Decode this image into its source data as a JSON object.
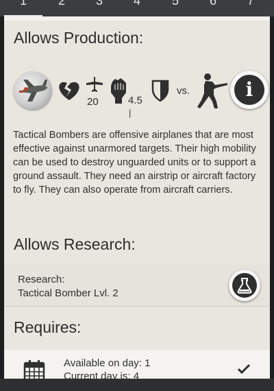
{
  "tabs": [
    "1",
    "2",
    "3",
    "4",
    "5",
    "6",
    "7"
  ],
  "production": {
    "heading": "Allows Production:",
    "stats": {
      "speed": "20",
      "attack": "4.5",
      "attack_sub": "|",
      "vs": "vs."
    },
    "description": "Tactical Bombers are offensive airplanes that are most effective against unarmored targets. Their high mobility can be used to destroy unguarded units or to support a ground assault. They need an airstrip or aircraft factory to fly. They can also operate from aircraft carriers."
  },
  "research": {
    "heading": "Allows Research:",
    "label": "Research:",
    "item": "Tactical Bomber Lvl. 2"
  },
  "requires": {
    "heading": "Requires:",
    "available": "Available on day: 1",
    "current": "Current day is: 4"
  },
  "icons": {
    "hp": "broken-heart-icon",
    "speed": "airplane-icon",
    "attack": "fist-icon",
    "armor": "shield-icon",
    "target": "soldier-icon",
    "info": "info-icon",
    "research": "flask-icon",
    "calendar": "calendar-icon",
    "check": "check-icon"
  },
  "colors": {
    "panel": "#e9e6df",
    "text": "#2f2f2f",
    "dark": "#2a2b2c"
  }
}
